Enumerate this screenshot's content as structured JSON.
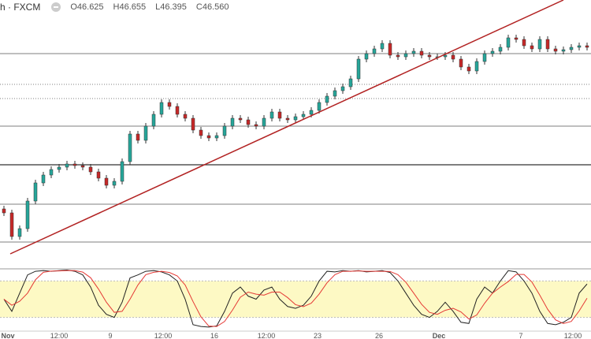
{
  "header": {
    "symbol": "h · FXCM",
    "o": "O46.625",
    "h": "H46.655",
    "l": "L46.395",
    "c": "C46.560"
  },
  "chart_data": {
    "type": "candlestick",
    "title": "FXCM",
    "price_range": [
      44.0,
      47.3
    ],
    "closes": [
      44.6,
      44.3,
      44.4,
      44.75,
      44.98,
      45.08,
      45.15,
      45.18,
      45.22,
      45.2,
      45.18,
      45.12,
      45.04,
      44.95,
      45.0,
      45.25,
      45.6,
      45.52,
      45.7,
      45.85,
      46.0,
      45.95,
      45.85,
      45.8,
      45.65,
      45.58,
      45.55,
      45.58,
      45.7,
      45.8,
      45.78,
      45.72,
      45.7,
      45.8,
      45.88,
      45.8,
      45.78,
      45.82,
      45.85,
      45.9,
      46.0,
      46.08,
      46.15,
      46.2,
      46.3,
      46.55,
      46.62,
      46.68,
      46.75,
      46.6,
      46.58,
      46.62,
      46.65,
      46.6,
      46.58,
      46.58,
      46.6,
      46.55,
      46.45,
      46.4,
      46.52,
      46.62,
      46.65,
      46.7,
      46.82,
      46.8,
      46.72,
      46.68,
      46.8,
      46.68,
      46.65,
      46.67,
      46.7,
      46.72,
      46.7
    ],
    "horizontal_levels": [
      {
        "price": 46.62,
        "style": "solid"
      },
      {
        "price": 46.23,
        "style": "dotted"
      },
      {
        "price": 46.05,
        "style": "dotted"
      },
      {
        "price": 45.7,
        "style": "solid"
      },
      {
        "price": 45.21,
        "style": "solid-dark"
      },
      {
        "price": 44.71,
        "style": "solid"
      },
      {
        "price": 44.23,
        "style": "solid"
      }
    ],
    "trendline": {
      "from_price": 44.08,
      "to_price": 47.3,
      "color": "#b22222"
    },
    "stochastic": {
      "k": [
        50,
        30,
        60,
        90,
        96,
        97,
        96,
        97,
        98,
        96,
        90,
        70,
        40,
        25,
        20,
        45,
        85,
        90,
        96,
        97,
        95,
        90,
        80,
        50,
        8,
        5,
        4,
        6,
        30,
        60,
        70,
        55,
        50,
        65,
        70,
        50,
        38,
        35,
        40,
        55,
        80,
        96,
        95,
        97,
        96,
        97,
        95,
        96,
        97,
        94,
        80,
        60,
        40,
        25,
        20,
        30,
        45,
        30,
        12,
        10,
        50,
        70,
        60,
        80,
        97,
        95,
        80,
        60,
        30,
        10,
        8,
        12,
        20,
        60,
        75
      ],
      "upper": 80,
      "lower": 20,
      "band_color": "#fdf9c4"
    },
    "colors": {
      "up": "#26a69a",
      "down": "#c62828"
    },
    "x_ticks": [
      "Nov",
      "12:00",
      "9",
      "12:00",
      "16",
      "12:00",
      "23",
      "26",
      "Dec",
      "7",
      "12:00"
    ]
  }
}
